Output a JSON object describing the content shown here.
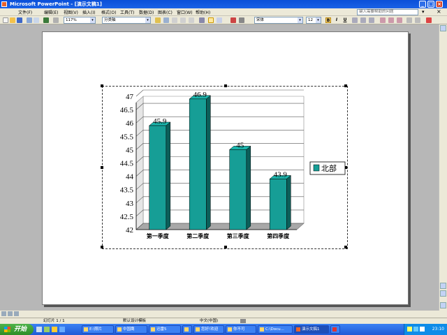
{
  "window": {
    "title": "Microsoft PowerPoint - [演示文稿1]"
  },
  "menu": {
    "items": [
      "文件(F)",
      "编辑(E)",
      "视图(V)",
      "插入(I)",
      "格式(O)",
      "工具(T)",
      "数据(D)",
      "图表(C)",
      "窗口(W)",
      "帮助(H)"
    ],
    "help_placeholder": "键入需要帮助的问题"
  },
  "toolbar": {
    "zoom": "117%",
    "chart_area": "分类轴",
    "font": "宋体",
    "font_size": "12"
  },
  "chart_data": {
    "type": "bar",
    "categories": [
      "第一季度",
      "第二季度",
      "第三季度",
      "第四季度"
    ],
    "series": [
      {
        "name": "北部",
        "values": [
          45.9,
          46.9,
          45,
          43.9
        ],
        "color": "#169e96"
      }
    ],
    "data_labels": [
      "45.9",
      "46.9",
      "45",
      "43.9"
    ],
    "ylim": [
      42,
      47
    ],
    "yticks": [
      "42",
      "42.5",
      "43",
      "43.5",
      "44",
      "44.5",
      "45",
      "45.5",
      "46",
      "46.5",
      "47"
    ],
    "grid": true,
    "legend": "right"
  },
  "status": {
    "slide": "幻灯片 1 / 1",
    "design": "默认设计模板",
    "language": "中文(中国)"
  },
  "taskbar": {
    "start": "开始",
    "tasks": [
      "E:\\照片",
      "中国鹰",
      "迅雷5",
      "",
      "您好!欢迎",
      "你不可",
      "C:\\Docu...",
      "演示文稿1",
      ""
    ],
    "clock": "23:10"
  }
}
